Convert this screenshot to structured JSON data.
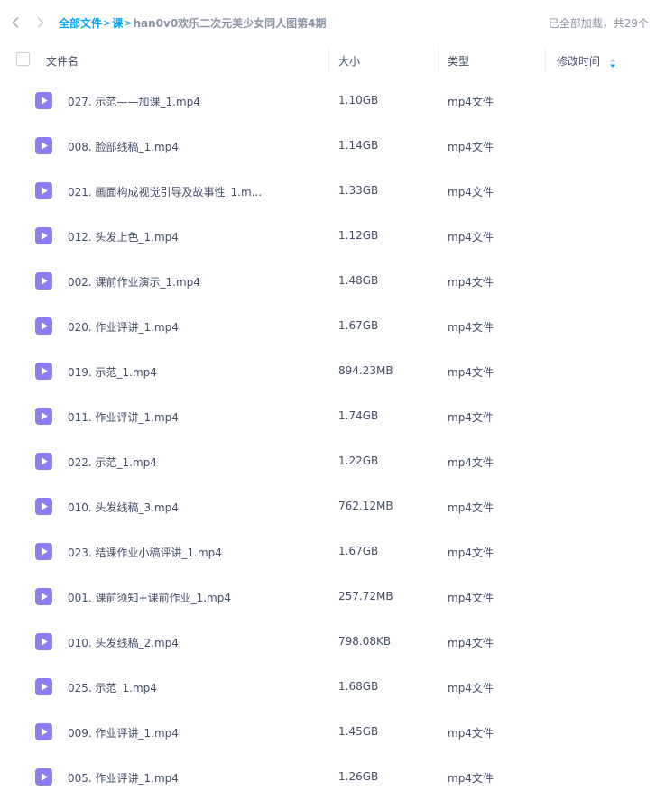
{
  "breadcrumb": {
    "root": "全部文件",
    "sep": ">",
    "parent": "课",
    "current": "han0v0欢乐二次元美少女同人图第4期"
  },
  "status": {
    "text": "已全部加载，共29个"
  },
  "header": {
    "name": "文件名",
    "size": "大小",
    "type": "类型",
    "modified": "修改时间"
  },
  "icons": {
    "back": "chevron-left-icon",
    "forward": "chevron-right-icon",
    "sort": "sort-arrow-icon",
    "file": "video-file-icon"
  },
  "colors": {
    "accent": "#06a7ff",
    "video_icon": "#8b7df2",
    "text": "#424e67",
    "muted": "#8a93a6"
  },
  "files": [
    {
      "name": "027. 示范——加课_1.mp4",
      "size": "1.10GB",
      "type": "mp4文件"
    },
    {
      "name": "008. 脸部线稿_1.mp4",
      "size": "1.14GB",
      "type": "mp4文件"
    },
    {
      "name": "021. 画面构成视觉引导及故事性_1.m...",
      "size": "1.33GB",
      "type": "mp4文件"
    },
    {
      "name": "012. 头发上色_1.mp4",
      "size": "1.12GB",
      "type": "mp4文件"
    },
    {
      "name": "002. 课前作业演示_1.mp4",
      "size": "1.48GB",
      "type": "mp4文件"
    },
    {
      "name": "020. 作业评讲_1.mp4",
      "size": "1.67GB",
      "type": "mp4文件"
    },
    {
      "name": "019. 示范_1.mp4",
      "size": "894.23MB",
      "type": "mp4文件"
    },
    {
      "name": "011. 作业评讲_1.mp4",
      "size": "1.74GB",
      "type": "mp4文件"
    },
    {
      "name": "022. 示范_1.mp4",
      "size": "1.22GB",
      "type": "mp4文件"
    },
    {
      "name": "010. 头发线稿_3.mp4",
      "size": "762.12MB",
      "type": "mp4文件"
    },
    {
      "name": "023. 结课作业小稿评讲_1.mp4",
      "size": "1.67GB",
      "type": "mp4文件"
    },
    {
      "name": "001. 课前须知+课前作业_1.mp4",
      "size": "257.72MB",
      "type": "mp4文件"
    },
    {
      "name": "010. 头发线稿_2.mp4",
      "size": "798.08KB",
      "type": "mp4文件"
    },
    {
      "name": "025. 示范_1.mp4",
      "size": "1.68GB",
      "type": "mp4文件"
    },
    {
      "name": "009. 作业评讲_1.mp4",
      "size": "1.45GB",
      "type": "mp4文件"
    },
    {
      "name": "005. 作业评讲_1.mp4",
      "size": "1.26GB",
      "type": "mp4文件"
    }
  ]
}
